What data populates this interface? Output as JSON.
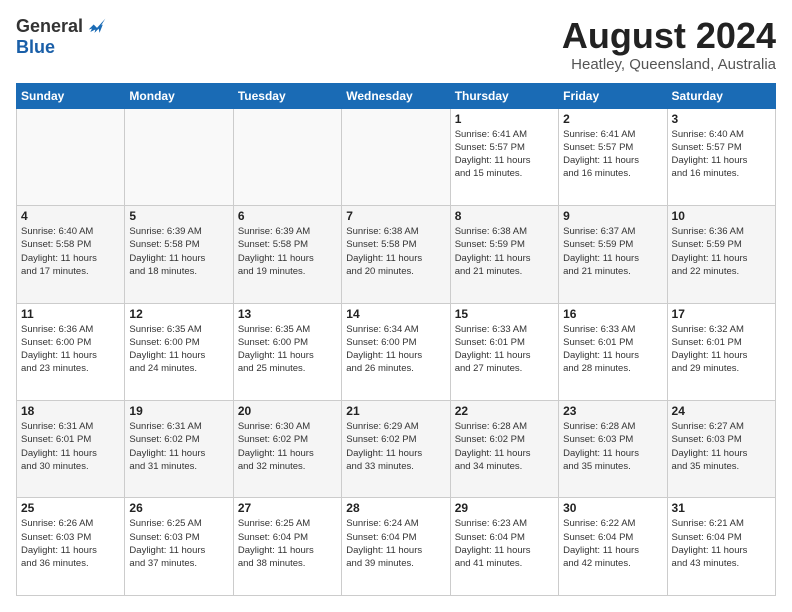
{
  "header": {
    "logo_general": "General",
    "logo_blue": "Blue",
    "month_title": "August 2024",
    "location": "Heatley, Queensland, Australia"
  },
  "weekdays": [
    "Sunday",
    "Monday",
    "Tuesday",
    "Wednesday",
    "Thursday",
    "Friday",
    "Saturday"
  ],
  "weeks": [
    [
      {
        "day": "",
        "info": ""
      },
      {
        "day": "",
        "info": ""
      },
      {
        "day": "",
        "info": ""
      },
      {
        "day": "",
        "info": ""
      },
      {
        "day": "1",
        "info": "Sunrise: 6:41 AM\nSunset: 5:57 PM\nDaylight: 11 hours\nand 15 minutes."
      },
      {
        "day": "2",
        "info": "Sunrise: 6:41 AM\nSunset: 5:57 PM\nDaylight: 11 hours\nand 16 minutes."
      },
      {
        "day": "3",
        "info": "Sunrise: 6:40 AM\nSunset: 5:57 PM\nDaylight: 11 hours\nand 16 minutes."
      }
    ],
    [
      {
        "day": "4",
        "info": "Sunrise: 6:40 AM\nSunset: 5:58 PM\nDaylight: 11 hours\nand 17 minutes."
      },
      {
        "day": "5",
        "info": "Sunrise: 6:39 AM\nSunset: 5:58 PM\nDaylight: 11 hours\nand 18 minutes."
      },
      {
        "day": "6",
        "info": "Sunrise: 6:39 AM\nSunset: 5:58 PM\nDaylight: 11 hours\nand 19 minutes."
      },
      {
        "day": "7",
        "info": "Sunrise: 6:38 AM\nSunset: 5:58 PM\nDaylight: 11 hours\nand 20 minutes."
      },
      {
        "day": "8",
        "info": "Sunrise: 6:38 AM\nSunset: 5:59 PM\nDaylight: 11 hours\nand 21 minutes."
      },
      {
        "day": "9",
        "info": "Sunrise: 6:37 AM\nSunset: 5:59 PM\nDaylight: 11 hours\nand 21 minutes."
      },
      {
        "day": "10",
        "info": "Sunrise: 6:36 AM\nSunset: 5:59 PM\nDaylight: 11 hours\nand 22 minutes."
      }
    ],
    [
      {
        "day": "11",
        "info": "Sunrise: 6:36 AM\nSunset: 6:00 PM\nDaylight: 11 hours\nand 23 minutes."
      },
      {
        "day": "12",
        "info": "Sunrise: 6:35 AM\nSunset: 6:00 PM\nDaylight: 11 hours\nand 24 minutes."
      },
      {
        "day": "13",
        "info": "Sunrise: 6:35 AM\nSunset: 6:00 PM\nDaylight: 11 hours\nand 25 minutes."
      },
      {
        "day": "14",
        "info": "Sunrise: 6:34 AM\nSunset: 6:00 PM\nDaylight: 11 hours\nand 26 minutes."
      },
      {
        "day": "15",
        "info": "Sunrise: 6:33 AM\nSunset: 6:01 PM\nDaylight: 11 hours\nand 27 minutes."
      },
      {
        "day": "16",
        "info": "Sunrise: 6:33 AM\nSunset: 6:01 PM\nDaylight: 11 hours\nand 28 minutes."
      },
      {
        "day": "17",
        "info": "Sunrise: 6:32 AM\nSunset: 6:01 PM\nDaylight: 11 hours\nand 29 minutes."
      }
    ],
    [
      {
        "day": "18",
        "info": "Sunrise: 6:31 AM\nSunset: 6:01 PM\nDaylight: 11 hours\nand 30 minutes."
      },
      {
        "day": "19",
        "info": "Sunrise: 6:31 AM\nSunset: 6:02 PM\nDaylight: 11 hours\nand 31 minutes."
      },
      {
        "day": "20",
        "info": "Sunrise: 6:30 AM\nSunset: 6:02 PM\nDaylight: 11 hours\nand 32 minutes."
      },
      {
        "day": "21",
        "info": "Sunrise: 6:29 AM\nSunset: 6:02 PM\nDaylight: 11 hours\nand 33 minutes."
      },
      {
        "day": "22",
        "info": "Sunrise: 6:28 AM\nSunset: 6:02 PM\nDaylight: 11 hours\nand 34 minutes."
      },
      {
        "day": "23",
        "info": "Sunrise: 6:28 AM\nSunset: 6:03 PM\nDaylight: 11 hours\nand 35 minutes."
      },
      {
        "day": "24",
        "info": "Sunrise: 6:27 AM\nSunset: 6:03 PM\nDaylight: 11 hours\nand 35 minutes."
      }
    ],
    [
      {
        "day": "25",
        "info": "Sunrise: 6:26 AM\nSunset: 6:03 PM\nDaylight: 11 hours\nand 36 minutes."
      },
      {
        "day": "26",
        "info": "Sunrise: 6:25 AM\nSunset: 6:03 PM\nDaylight: 11 hours\nand 37 minutes."
      },
      {
        "day": "27",
        "info": "Sunrise: 6:25 AM\nSunset: 6:04 PM\nDaylight: 11 hours\nand 38 minutes."
      },
      {
        "day": "28",
        "info": "Sunrise: 6:24 AM\nSunset: 6:04 PM\nDaylight: 11 hours\nand 39 minutes."
      },
      {
        "day": "29",
        "info": "Sunrise: 6:23 AM\nSunset: 6:04 PM\nDaylight: 11 hours\nand 41 minutes."
      },
      {
        "day": "30",
        "info": "Sunrise: 6:22 AM\nSunset: 6:04 PM\nDaylight: 11 hours\nand 42 minutes."
      },
      {
        "day": "31",
        "info": "Sunrise: 6:21 AM\nSunset: 6:04 PM\nDaylight: 11 hours\nand 43 minutes."
      }
    ]
  ]
}
